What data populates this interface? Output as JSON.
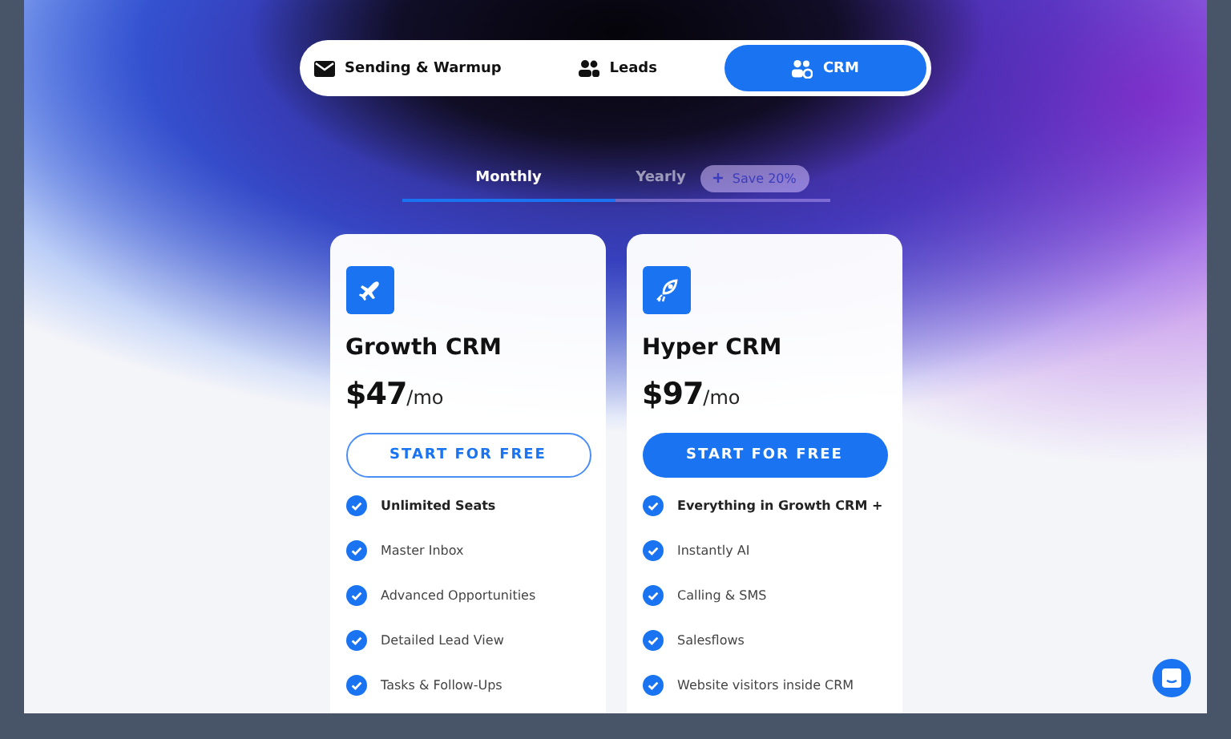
{
  "product_tabs": [
    {
      "label": "Sending & Warmup",
      "selected": false
    },
    {
      "label": "Leads",
      "selected": false
    },
    {
      "label": "CRM",
      "selected": true
    }
  ],
  "billing": {
    "options": [
      {
        "label": "Monthly",
        "selected": true
      },
      {
        "label": "Yearly",
        "selected": false
      }
    ],
    "badge": "Save 20%"
  },
  "plans": [
    {
      "name": "Growth CRM",
      "price": "$47",
      "period": "/mo",
      "button": {
        "label": "START FOR FREE",
        "kind": "outline"
      },
      "features": [
        {
          "text": "Unlimited Seats",
          "emphasized": true
        },
        {
          "text": "Master Inbox",
          "emphasized": false
        },
        {
          "text": "Advanced Opportunities",
          "emphasized": false
        },
        {
          "text": "Detailed Lead View",
          "emphasized": false
        },
        {
          "text": "Tasks & Follow-Ups",
          "emphasized": false
        }
      ]
    },
    {
      "name": "Hyper CRM",
      "price": "$97",
      "period": "/mo",
      "button": {
        "label": "START FOR FREE",
        "kind": "filled"
      },
      "features": [
        {
          "text": "Everything in Growth CRM +",
          "emphasized": true
        },
        {
          "text": "Instantly AI",
          "emphasized": false
        },
        {
          "text": "Calling & SMS",
          "emphasized": false
        },
        {
          "text": "Salesflows",
          "emphasized": false
        },
        {
          "text": "Website visitors inside CRM",
          "emphasized": false
        }
      ]
    }
  ]
}
